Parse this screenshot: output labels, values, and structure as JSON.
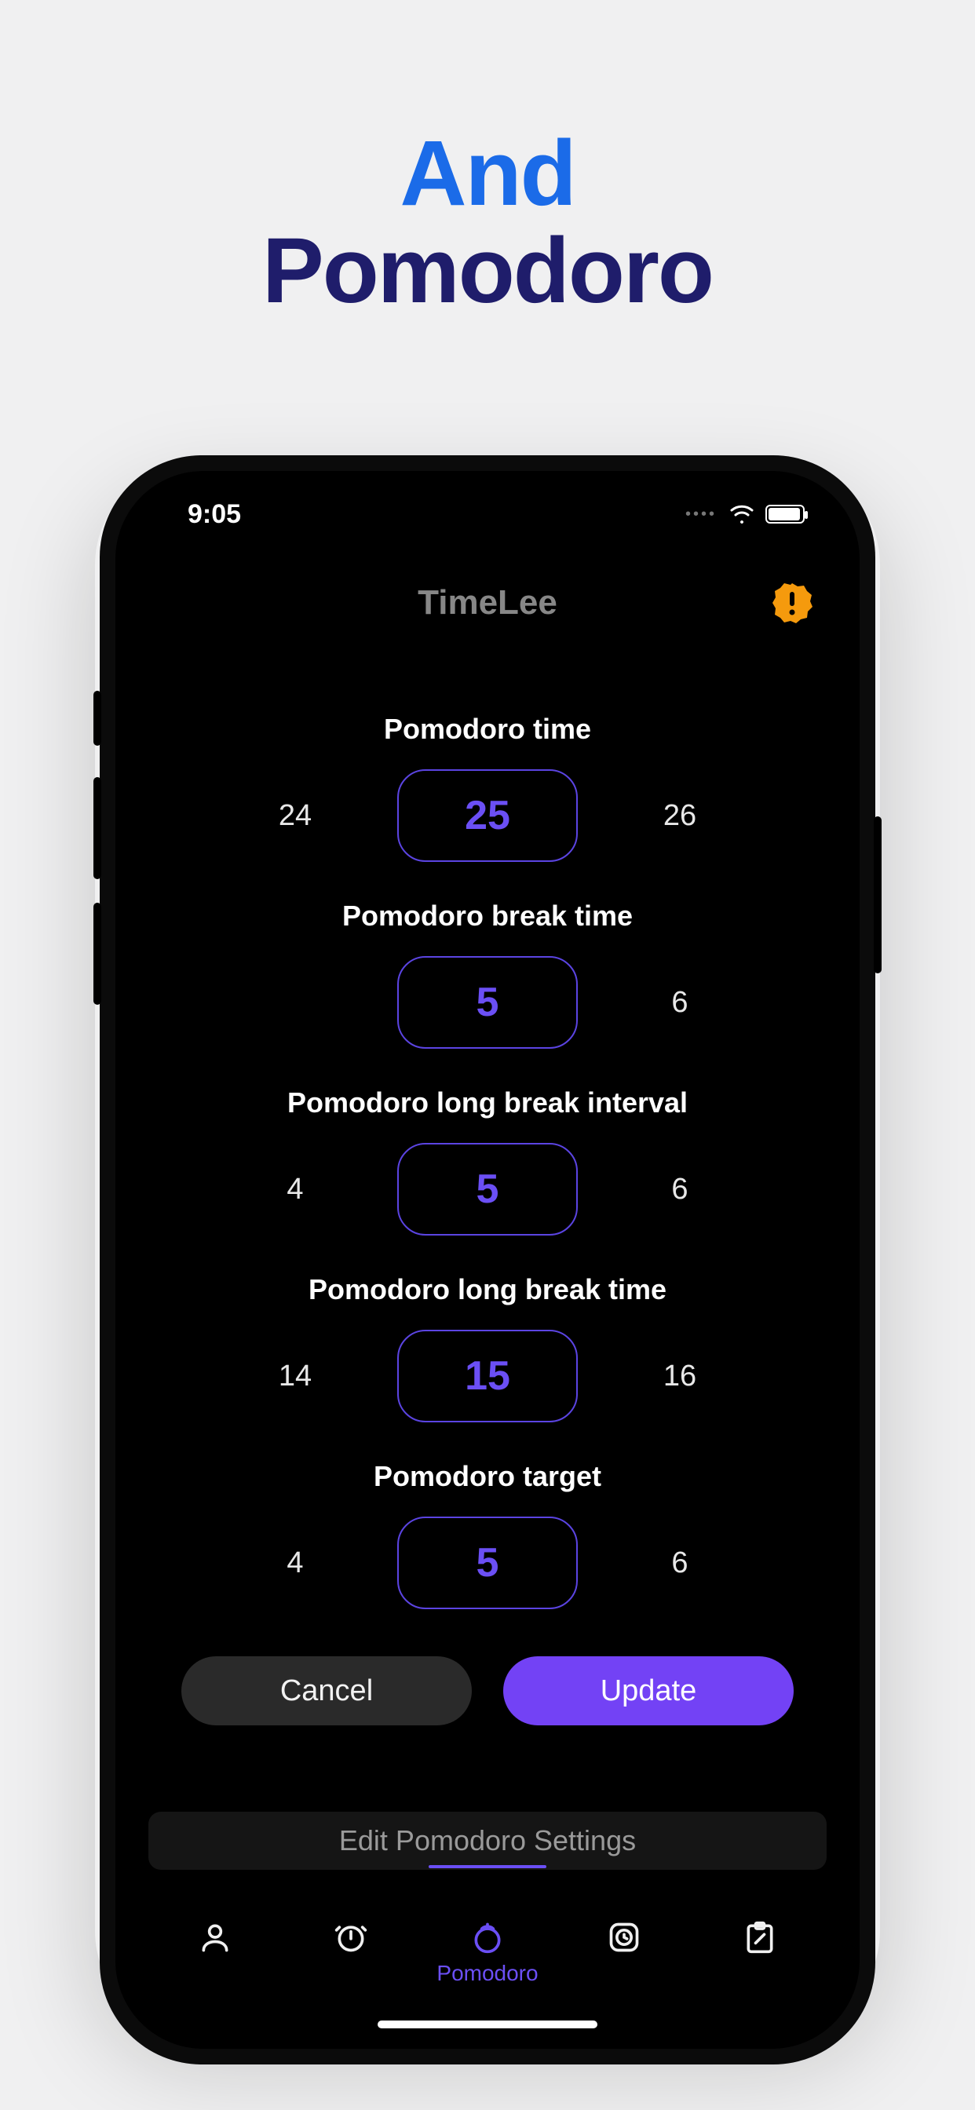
{
  "promo": {
    "line1": "And",
    "line2": "Pomodoro"
  },
  "status": {
    "time": "9:05"
  },
  "header": {
    "title": "TimeLee"
  },
  "pickers": [
    {
      "label": "Pomodoro time",
      "prev": "24",
      "value": "25",
      "next": "26"
    },
    {
      "label": "Pomodoro break time",
      "prev": "",
      "value": "5",
      "next": "6"
    },
    {
      "label": "Pomodoro long break interval",
      "prev": "4",
      "value": "5",
      "next": "6"
    },
    {
      "label": "Pomodoro long break time",
      "prev": "14",
      "value": "15",
      "next": "16"
    },
    {
      "label": "Pomodoro target",
      "prev": "4",
      "value": "5",
      "next": "6"
    }
  ],
  "actions": {
    "cancel": "Cancel",
    "update": "Update"
  },
  "segment": {
    "label": "Edit Pomodoro Settings"
  },
  "tabs": {
    "active_label": "Pomodoro"
  },
  "colors": {
    "accent": "#6b4ff5",
    "accent_button": "#7342f5",
    "promo_blue": "#1b6be8",
    "promo_navy": "#1f1d6b",
    "alert": "#f59a0d"
  }
}
